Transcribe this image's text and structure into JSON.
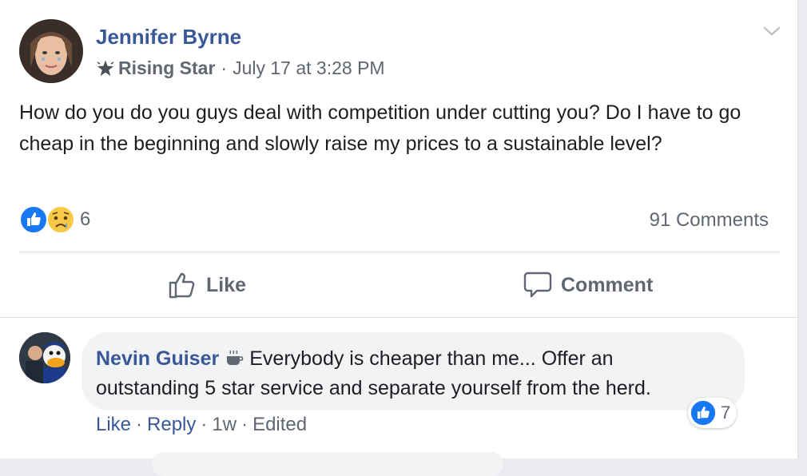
{
  "post": {
    "author": "Jennifer Byrne",
    "badge": "Rising Star",
    "separator": "·",
    "timestamp": "July 17 at 3:28 PM",
    "text": "How do you do you guys deal with competition under cutting you? Do I have to go cheap in the beginning and slowly raise my prices to a sustainable level?",
    "reaction_count": "6",
    "comments_count": "91 Comments"
  },
  "actions": {
    "like_label": "Like",
    "comment_label": "Comment"
  },
  "comment": {
    "author": "Nevin Guiser",
    "text": "Everybody is cheaper than me... Offer an outstanding 5 star service and separate yourself from the herd.",
    "reaction_count": "7",
    "like_label": "Like",
    "reply_label": "Reply",
    "age": "1w",
    "edited_label": "Edited",
    "separator": "·"
  },
  "colors": {
    "link": "#385898",
    "meta": "#606770",
    "like_blue": "#1877f2",
    "bubble": "#f2f3f5"
  },
  "icons": [
    "star-badge-icon",
    "chevron-down-icon",
    "like-reaction-icon",
    "sad-reaction-icon",
    "thumbs-up-outline-icon",
    "comment-outline-icon",
    "coffee-cup-icon"
  ]
}
